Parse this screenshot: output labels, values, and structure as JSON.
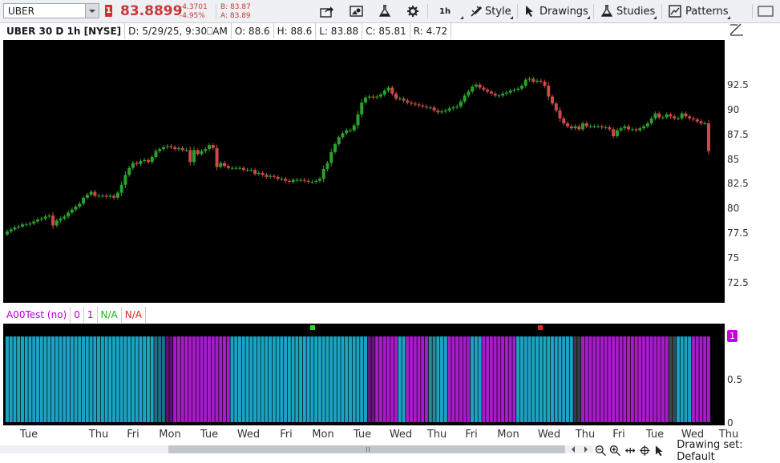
{
  "toolbar": {
    "symbol": "UBER",
    "alert_count": "1",
    "last_price": "83.8899",
    "net_change": "-4.3701",
    "pct_change": "-4.95%",
    "bid": "B: 83.87",
    "ask": "A: 83.89",
    "timeframe": "1h",
    "style_label": "Style",
    "drawings_label": "Drawings",
    "studies_label": "Studies",
    "patterns_label": "Patterns",
    "colors": {
      "down": "#c83838"
    }
  },
  "price_header": {
    "title": "UBER 30 D 1h [NYSE]",
    "date": "D: 5/29/25, 9:30⎕AM",
    "open": "O: 88.6",
    "high": "H: 88.6",
    "low": "L: 83.88",
    "close": "C: 85.81",
    "range": "R: 4.72"
  },
  "price_axis": {
    "ticks": [
      "92.5",
      "90",
      "87.5",
      "85",
      "82.5",
      "80",
      "77.5",
      "75",
      "72.5"
    ],
    "min": 70.5,
    "max": 97
  },
  "study_header": {
    "name": "A00Test (no)",
    "v0": "0",
    "v1": "1",
    "na_green": "N/A",
    "na_red": "N/A"
  },
  "study_axis": {
    "ticks": [
      "0.5",
      "0"
    ],
    "badge": "1"
  },
  "x_axis": {
    "labels": [
      "Tue",
      "Thu",
      "Fri",
      "Mon",
      "Tue",
      "Wed",
      "Fri",
      "Mon",
      "Tue",
      "Wed",
      "Thu",
      "Fri",
      "Mon",
      "Wed",
      "Thu",
      "Fri",
      "Tue",
      "Wed",
      "Thu"
    ]
  },
  "bottom": {
    "drawing_set": "Drawing set: Default"
  },
  "chart_data": {
    "type": "candlestick",
    "up_color": "#2ca02c",
    "down_color": "#d04848",
    "closes": [
      77.7,
      77.9,
      78.1,
      78.2,
      78.4,
      78.4,
      78.5,
      78.7,
      78.9,
      79.0,
      79.2,
      79.3,
      78.3,
      78.8,
      79.0,
      79.2,
      79.6,
      79.9,
      80.2,
      80.5,
      81.1,
      81.4,
      81.7,
      81.3,
      81.3,
      81.3,
      81.2,
      81.3,
      81.1,
      81.6,
      82.4,
      83.4,
      84.1,
      84.6,
      84.5,
      84.8,
      84.9,
      84.7,
      85.2,
      85.8,
      86.0,
      86.2,
      86.3,
      86.2,
      86.0,
      86.1,
      85.9,
      85.9,
      84.7,
      85.9,
      85.5,
      85.8,
      86.0,
      86.4,
      86.1,
      84.2,
      84.6,
      84.3,
      84.1,
      84.1,
      84.1,
      84.1,
      83.9,
      83.9,
      83.9,
      83.5,
      83.6,
      83.4,
      83.2,
      83.3,
      83.2,
      83.0,
      83.0,
      82.8,
      82.7,
      82.9,
      82.9,
      82.9,
      82.8,
      82.7,
      82.7,
      82.8,
      83.0,
      84.0,
      84.6,
      85.7,
      86.5,
      87.2,
      87.6,
      87.9,
      87.9,
      88.4,
      89.5,
      90.7,
      91.2,
      91.3,
      91.2,
      91.3,
      91.5,
      91.9,
      92.2,
      91.6,
      91.1,
      91.1,
      90.9,
      90.7,
      90.6,
      90.5,
      90.4,
      90.3,
      90.2,
      90.2,
      89.9,
      89.7,
      89.8,
      89.9,
      90.1,
      90.2,
      90.3,
      90.8,
      91.4,
      91.8,
      92.3,
      92.5,
      92.2,
      92.0,
      91.8,
      91.6,
      91.4,
      91.4,
      91.6,
      91.7,
      91.9,
      92.0,
      92.1,
      92.4,
      93.0,
      93.1,
      92.8,
      92.9,
      92.8,
      92.4,
      91.3,
      90.6,
      89.9,
      89.1,
      88.6,
      88.3,
      88.1,
      88.3,
      88.0,
      88.6,
      88.3,
      88.3,
      88.3,
      88.3,
      88.2,
      88.2,
      88.0,
      87.3,
      87.9,
      88.1,
      88.3,
      88.0,
      88.0,
      87.9,
      88.1,
      88.3,
      88.6,
      89.1,
      89.6,
      89.2,
      89.2,
      89.5,
      89.3,
      89.1,
      89.1,
      89.6,
      89.3,
      89.1,
      89.0,
      88.8,
      88.6,
      88.6,
      85.8
    ]
  }
}
